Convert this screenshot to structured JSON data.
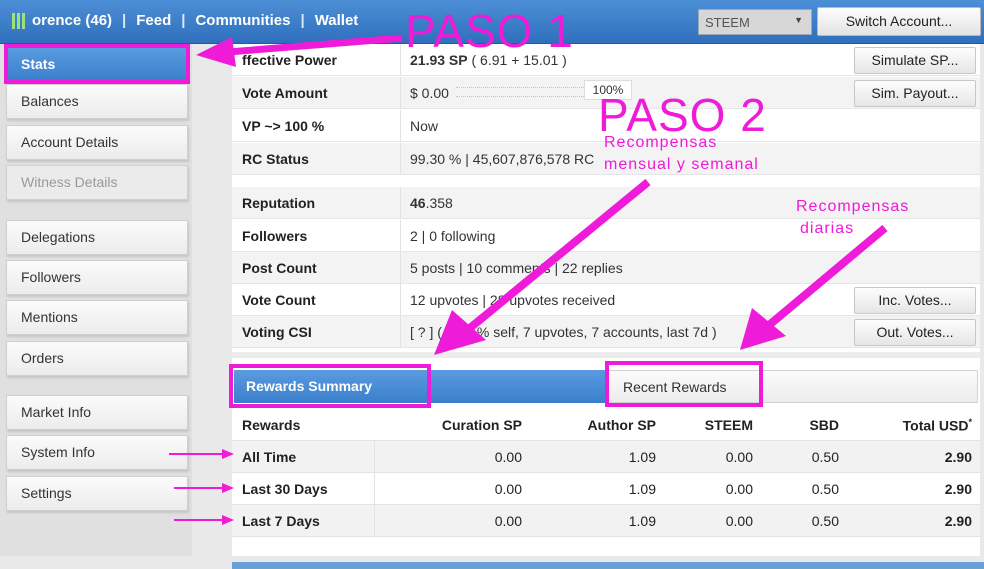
{
  "topbar": {
    "nav": [
      "orence (46)",
      "Feed",
      "Communities",
      "Wallet"
    ],
    "chain": "STEEM",
    "switch_label": "Switch Account..."
  },
  "sidebar": {
    "items": [
      "Stats",
      "Balances",
      "Account Details",
      "Witness Details",
      "Delegations",
      "Followers",
      "Mentions",
      "Orders",
      "Market Info",
      "System Info",
      "Settings"
    ]
  },
  "stats": {
    "effective_power": {
      "label": "ffective Power",
      "value_bold": "21.93 SP",
      "value_rest": " ( 6.91 + 15.01 )",
      "button": "Simulate SP..."
    },
    "vote_amount": {
      "label": "Vote Amount",
      "value": "$ 0.00",
      "percent": "100%",
      "button": "Sim. Payout..."
    },
    "vp": {
      "label": "VP ~> 100 %",
      "value": "Now"
    },
    "rc": {
      "label": "RC Status",
      "value": "99.30 %  |  45,607,876,578 RC"
    },
    "reputation": {
      "label": "Reputation",
      "value_bold": "46",
      "value_rest": ".358"
    },
    "followers": {
      "label": "Followers",
      "value": "2  |  0 following"
    },
    "post_count": {
      "label": "Post Count",
      "value": "5 posts  |  10 comments  |  22 replies"
    },
    "vote_count": {
      "label": "Vote Count",
      "value": "12 upvotes  |  28 upvotes received",
      "button": "Inc. Votes..."
    },
    "voting_csi": {
      "label": "Voting CSI",
      "value": "[ ? ] ( 0.00 % self, 7 upvotes, 7 accounts, last 7d )",
      "button": "Out. Votes..."
    }
  },
  "tabs": {
    "active": "Rewards Summary",
    "inactive": "Recent Rewards"
  },
  "rewards": {
    "headers": [
      "Rewards",
      "Curation SP",
      "Author SP",
      "STEEM",
      "SBD",
      "Total USD"
    ],
    "total_marker": "*",
    "rows": [
      {
        "label": "All Time",
        "curation": "0.00",
        "author": "1.09",
        "steem": "0.00",
        "sbd": "0.50",
        "total": "2.90"
      },
      {
        "label": "Last 30 Days",
        "curation": "0.00",
        "author": "1.09",
        "steem": "0.00",
        "sbd": "0.50",
        "total": "2.90"
      },
      {
        "label": "Last 7 Days",
        "curation": "0.00",
        "author": "1.09",
        "steem": "0.00",
        "sbd": "0.50",
        "total": "2.90"
      }
    ]
  },
  "annotations": {
    "step1": "PASO 1",
    "step2": "PASO 2",
    "monthly_weekly": [
      "Recompensas",
      "mensual y semanal"
    ],
    "daily": [
      "Recompensas",
      "diarias"
    ],
    "color": "#ee1bd8"
  }
}
